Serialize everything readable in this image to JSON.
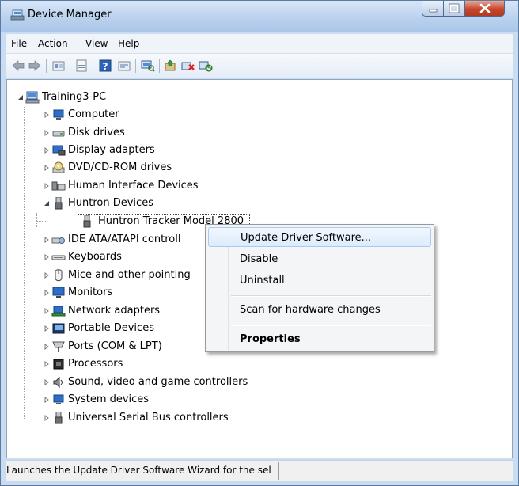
{
  "window": {
    "title": "Device Manager"
  },
  "menu": {
    "file": "File",
    "action": "Action",
    "view": "View",
    "help": "Help"
  },
  "toolbar": {
    "icons": [
      "back-icon",
      "forward-icon",
      "up-folder-icon",
      "properties-icon",
      "help-icon",
      "show-hidden-icon",
      "scan-hardware-icon",
      "update-driver-icon",
      "uninstall-icon",
      "enable-device-icon"
    ]
  },
  "tree": {
    "root": "Training3-PC",
    "items": [
      {
        "label": "Computer",
        "icon": "computer-icon"
      },
      {
        "label": "Disk drives",
        "icon": "disk-drive-icon"
      },
      {
        "label": "Display adapters",
        "icon": "display-adapter-icon"
      },
      {
        "label": "DVD/CD-ROM drives",
        "icon": "dvd-drive-icon"
      },
      {
        "label": "Human Interface Devices",
        "icon": "hid-icon"
      },
      {
        "label": "Huntron Devices",
        "icon": "usb-plug-icon"
      },
      {
        "label": "Huntron Tracker Model 2800",
        "icon": "usb-plug-icon"
      },
      {
        "label": "IDE ATA/ATAPI controll",
        "icon": "ide-controller-icon"
      },
      {
        "label": "Keyboards",
        "icon": "keyboard-icon"
      },
      {
        "label": "Mice and other pointing",
        "icon": "mouse-icon"
      },
      {
        "label": "Monitors",
        "icon": "monitor-icon"
      },
      {
        "label": "Network adapters",
        "icon": "network-adapter-icon"
      },
      {
        "label": "Portable Devices",
        "icon": "portable-device-icon"
      },
      {
        "label": "Ports (COM & LPT)",
        "icon": "port-icon"
      },
      {
        "label": "Processors",
        "icon": "processor-icon"
      },
      {
        "label": "Sound, video and game controllers",
        "icon": "sound-icon"
      },
      {
        "label": "System devices",
        "icon": "system-device-icon"
      },
      {
        "label": "Universal Serial Bus controllers",
        "icon": "usb-plug-icon"
      }
    ]
  },
  "context_menu": {
    "update": "Update Driver Software...",
    "disable": "Disable",
    "uninstall": "Uninstall",
    "scan": "Scan for hardware changes",
    "properties": "Properties"
  },
  "status": {
    "text": "Launches the Update Driver Software Wizard for the sel"
  },
  "colors": {
    "title_bar": "#bdd3ee",
    "close_button": "#c8462e",
    "menu_highlight": "#dcebfc"
  }
}
